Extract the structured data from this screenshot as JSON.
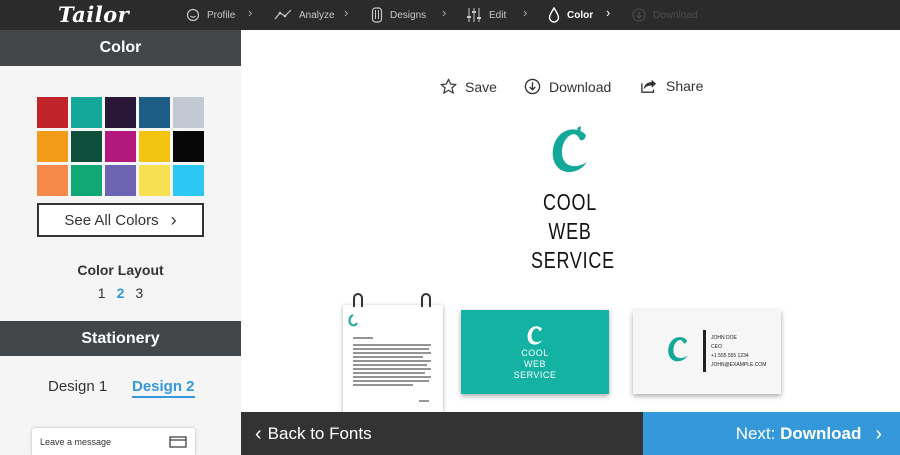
{
  "brand": {
    "logo_text": "Tailor",
    "accent": "#3498db",
    "teal": "#14b2a2"
  },
  "steps": [
    {
      "label": "Profile",
      "icon": "smiley-icon",
      "state": "done"
    },
    {
      "label": "Analyze",
      "icon": "analyze-icon",
      "state": "done"
    },
    {
      "label": "Designs",
      "icon": "designs-icon",
      "state": "done"
    },
    {
      "label": "Edit",
      "icon": "sliders-icon",
      "state": "done"
    },
    {
      "label": "Color",
      "icon": "droplet-icon",
      "state": "active"
    },
    {
      "label": "Download",
      "icon": "download-icon",
      "state": "disabled"
    }
  ],
  "sidebar": {
    "color_title": "Color",
    "swatches": [
      "#c0232a",
      "#14a89b",
      "#2a1738",
      "#1d5d86",
      "#c2c9d3",
      "#f39c1a",
      "#0e4f3b",
      "#b3197c",
      "#f2c40f",
      "#070707",
      "#f5894a",
      "#10a874",
      "#6c64b2",
      "#f6e153",
      "#2dc7f3"
    ],
    "see_all_label": "See All Colors",
    "layout_title": "Color Layout",
    "layout_options": [
      "1",
      "2",
      "3"
    ],
    "layout_selected": "2",
    "stationery_title": "Stationery",
    "design1_label": "Design 1",
    "design2_label": "Design 2",
    "leave_message": "Leave a message"
  },
  "actions": {
    "save": "Save",
    "download": "Download",
    "share": "Share"
  },
  "logo_preview": {
    "letter": "C",
    "line1": "COOL",
    "line2": "WEB",
    "line3": "SERVICE"
  },
  "card_back": {
    "name": "JOHN DOE",
    "title": "CEO",
    "phone": "+1 555 555 1234",
    "email": "JOHN@EXAMPLE.COM"
  },
  "footer": {
    "back_label": "Back to Fonts",
    "next_prefix": "Next:",
    "next_label": "Download"
  }
}
